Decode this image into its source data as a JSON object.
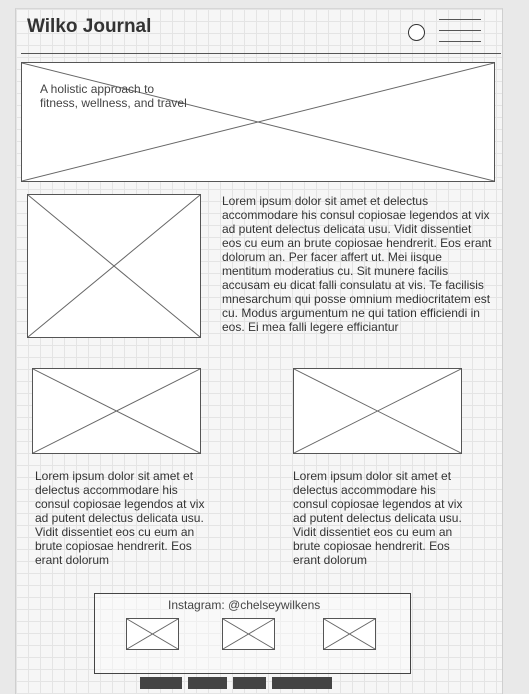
{
  "header": {
    "brand": "Wilko Journal",
    "search_icon": "search-icon",
    "menu_icon": "hamburger-menu-icon"
  },
  "hero": {
    "tagline": "A holistic approach to\nfitness, wellness, and travel",
    "image_icon": "image-placeholder-icon"
  },
  "feature": {
    "body": "Lorem ipsum dolor sit amet et delectus accommodare his consul copiosae legendos at vix ad putent delectus delicata usu. Vidit dissentiet eos cu eum an brute copiosae hendrerit. Eos erant dolorum an. Per facer affert ut. Mei iisque mentitum moderatius cu. Sit munere facilis accusam eu dicat falli consulatu at vis. Te facilisis mnesarchum qui posse omnium mediocritatem est cu. Modus argumentum ne qui tation efficiendi in eos. Ei mea falli legere efficiantur"
  },
  "cards": [
    {
      "body": "Lorem ipsum dolor sit amet et delectus accommodare his consul copiosae legendos at vix ad putent delectus delicata usu. Vidit dissentiet eos cu eum an brute copiosae hendrerit. Eos erant dolorum"
    },
    {
      "body": "Lorem ipsum dolor sit amet et delectus accommodare his consul copiosae legendos at vix ad putent delectus delicata usu. Vidit dissentiet eos cu eum an brute copiosae hendrerit. Eos erant dolorum"
    }
  ],
  "instagram": {
    "handle": "Instagram: @chelseywilkens"
  },
  "colors": {
    "line": "#555555",
    "footer_bar": "#444444"
  }
}
